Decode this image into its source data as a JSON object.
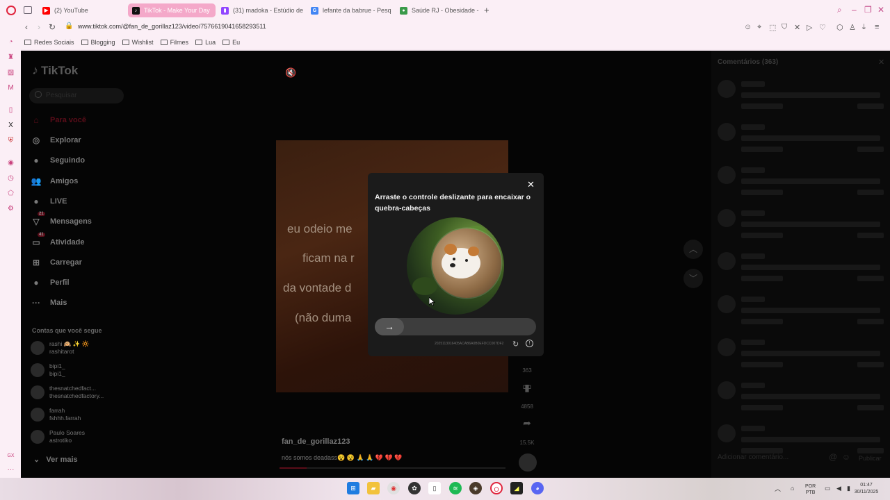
{
  "browser": {
    "tabs": [
      {
        "label": "(2) YouTube",
        "favicon": "youtube-icon",
        "color": "#ff0000",
        "active": false
      },
      {
        "label": "TikTok - Make Your Day",
        "favicon": "tiktok-icon",
        "color": "#111111",
        "active": true
      },
      {
        "label": "(31) madoka - Estúdio de",
        "favicon": "twitch-icon",
        "color": "#9146ff",
        "active": false
      },
      {
        "label": "lefante da babrue - Pesq",
        "favicon": "google-icon",
        "color": "#4285f4",
        "active": false
      },
      {
        "label": "Saúde RJ - Obesidade - C",
        "favicon": "gov-icon",
        "color": "#3a9a4a",
        "active": false
      }
    ],
    "new_tab": "+",
    "url": "www.tiktok.com/@fan_de_gorillaz123/video/7576619041658293511",
    "bookmarks": [
      "Redes Sociais",
      "Blogging",
      "Wishlist",
      "Filmes",
      "Lua",
      "Eu"
    ]
  },
  "tiktok": {
    "logo": "TikTok",
    "search_placeholder": "Pesquisar",
    "nav": [
      {
        "label": "Para você",
        "icon": "home-icon",
        "glyph": "⌂"
      },
      {
        "label": "Explorar",
        "icon": "compass-icon",
        "glyph": "◎"
      },
      {
        "label": "Seguindo",
        "icon": "following-icon",
        "glyph": "●"
      },
      {
        "label": "Amigos",
        "icon": "friends-icon",
        "glyph": "👥"
      },
      {
        "label": "LIVE",
        "icon": "live-icon",
        "glyph": "●"
      },
      {
        "label": "Mensagens",
        "icon": "messages-icon",
        "glyph": "▽",
        "badge": "21"
      },
      {
        "label": "Atividade",
        "icon": "activity-icon",
        "glyph": "▭",
        "badge": "41"
      },
      {
        "label": "Carregar",
        "icon": "upload-icon",
        "glyph": "⊞"
      },
      {
        "label": "Perfil",
        "icon": "profile-icon",
        "glyph": "●"
      },
      {
        "label": "Mais",
        "icon": "more-icon",
        "glyph": "···"
      }
    ],
    "following_title": "Contas que você segue",
    "following": [
      {
        "name": "rashi 🙉 ✨ 🔆",
        "handle": "rashitarot"
      },
      {
        "name": "bipi1_",
        "handle": "bipi1_"
      },
      {
        "name": "thesnatchedfact...",
        "handle": "thesnatchedfactory..."
      },
      {
        "name": "farrah",
        "handle": "fshhh.farrah"
      },
      {
        "name": "Paulo Soares",
        "handle": "astrotiko"
      }
    ],
    "see_more": "Ver mais"
  },
  "video": {
    "lines": [
      "eu odeio me",
      "ficam na r",
      "da vontade d",
      "(não duma "
    ],
    "author": "fan_de_gorillaz123",
    "caption": "nós somos deadass😵 😵 🙏 🙏 💔 💔 💔",
    "progress": 0.12,
    "actions": [
      {
        "icon": "comment-icon",
        "count": "363"
      },
      {
        "icon": "bookmark-icon",
        "count": "4858"
      },
      {
        "icon": "share-icon",
        "count": "15.5K"
      }
    ]
  },
  "comments": {
    "title": "Comentários (363)",
    "input_placeholder": "Adicionar comentário...",
    "post_label": "Publicar"
  },
  "captcha": {
    "title": "Arraste o controle deslizante para encaixar o quebra-cabeças",
    "id_code": "2025113016405ACAB6A0B0EFDCC007DF2",
    "slider_position": 0
  },
  "taskbar": {
    "lang": "POR\nPTB",
    "time": "01:47",
    "date": "30/11/2025"
  }
}
